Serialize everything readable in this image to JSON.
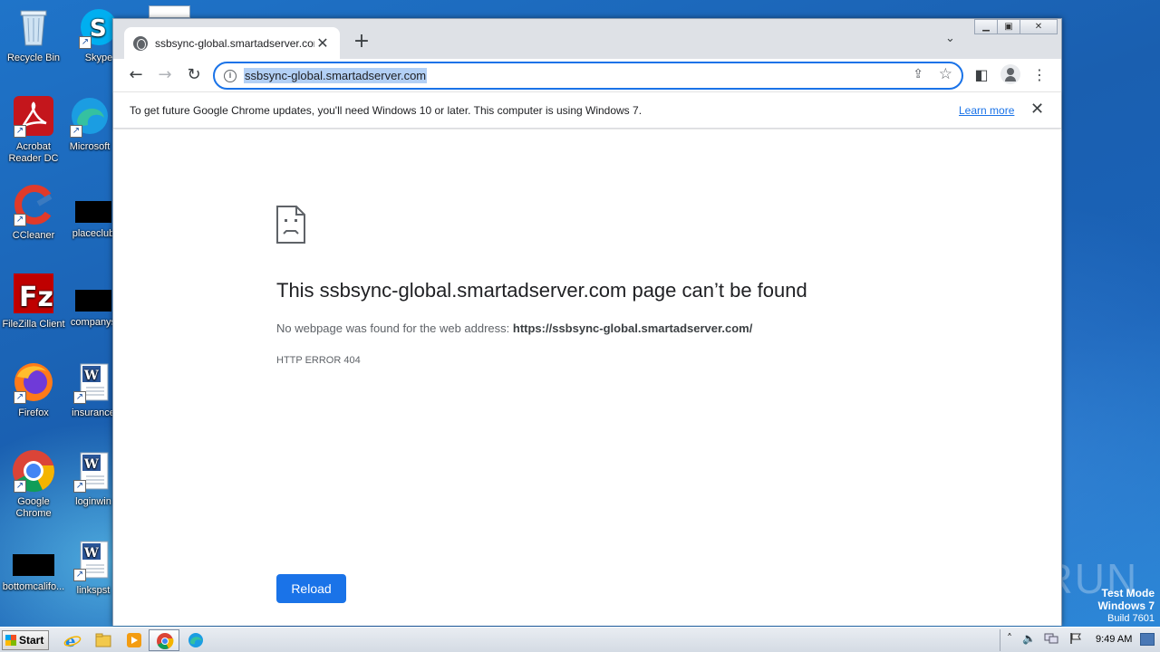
{
  "desktop": {
    "icons": [
      {
        "label": "Recycle Bin",
        "icon": "recycle-bin-icon"
      },
      {
        "label": "Skype",
        "icon": "skype-icon"
      },
      {
        "label": "Acrobat Reader DC",
        "icon": "acrobat-icon"
      },
      {
        "label": "Microsoft",
        "icon": "edge-icon"
      },
      {
        "label": "CCleaner",
        "icon": "ccleaner-icon"
      },
      {
        "label": "placeclub",
        "icon": "black-file-icon"
      },
      {
        "label": "FileZilla Client",
        "icon": "filezilla-icon"
      },
      {
        "label": "companys",
        "icon": "black-file-icon"
      },
      {
        "label": "Firefox",
        "icon": "firefox-icon"
      },
      {
        "label": "insurance",
        "icon": "word-doc-icon"
      },
      {
        "label": "Google Chrome",
        "icon": "chrome-icon"
      },
      {
        "label": "loginwin",
        "icon": "word-doc-icon"
      },
      {
        "label": "bottomcalifo...",
        "icon": "black-file-icon"
      },
      {
        "label": "linkspst",
        "icon": "word-doc-icon"
      }
    ],
    "watermark": "ANY RUN",
    "test_mode": {
      "line1": "Test Mode",
      "line2": "Windows 7",
      "line3": "Build 7601"
    }
  },
  "browser": {
    "tab": {
      "title": "ssbsync-global.smartadserver.com",
      "close": "✕"
    },
    "new_tab": "+",
    "tab_search": "⌄",
    "window_controls": {
      "minimize": "▁",
      "restore": "▣",
      "close": "✕"
    },
    "nav": {
      "back": "←",
      "forward": "→",
      "reload": "↻"
    },
    "omnibox": {
      "url": "ssbsync-global.smartadserver.com",
      "info": "i",
      "share": "⇪",
      "star": "☆"
    },
    "toolbar": {
      "side_panel": "◧",
      "menu": "⋮"
    },
    "infobar": {
      "message": "To get future Google Chrome updates, you'll need Windows 10 or later. This computer is using Windows 7.",
      "link": "Learn more",
      "close": "✕"
    },
    "error": {
      "title": "This ssbsync-global.smartadserver.com page can’t be found",
      "message_prefix": "No webpage was found for the web address: ",
      "message_url": "https://ssbsync-global.smartadserver.com/",
      "code": "HTTP ERROR 404",
      "reload": "Reload"
    }
  },
  "taskbar": {
    "start": "Start",
    "clock": "9:49 AM",
    "tray_up": "˄"
  },
  "colors": {
    "accent": "#1a73e8",
    "selection": "#b3d0f5",
    "wallpaper": "#1d6fc4"
  }
}
